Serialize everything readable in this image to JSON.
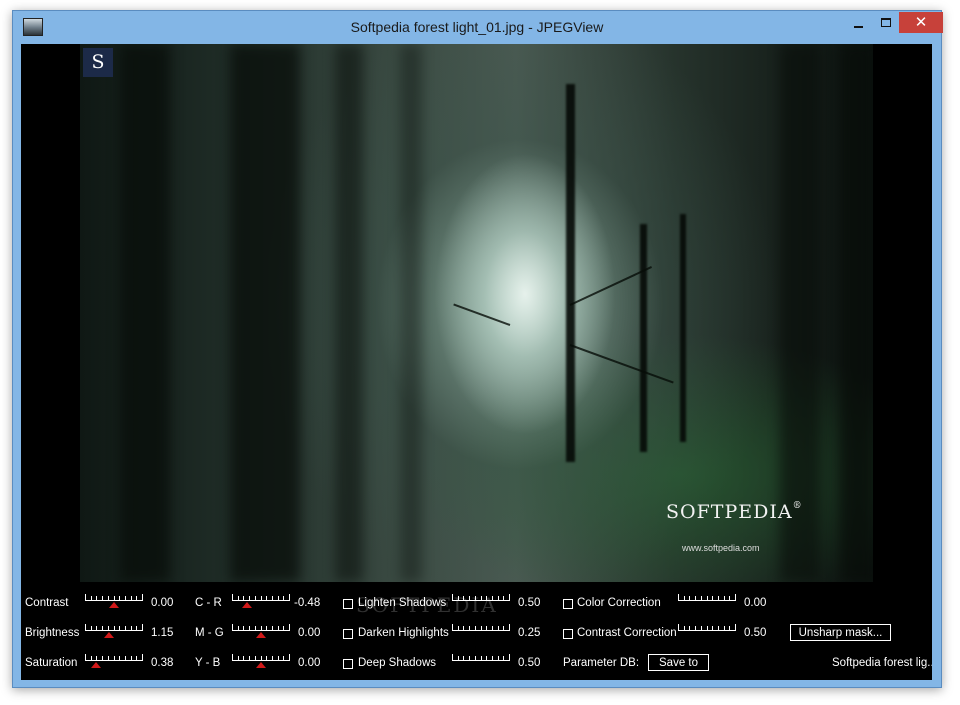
{
  "window": {
    "title": "Softpedia forest light_01.jpg - JPEGView",
    "close_label": "✕"
  },
  "image": {
    "corner_logo": "S",
    "brand": "SOFTPEDIA",
    "brand_mark": "®",
    "brand_url": "www.softpedia.com",
    "watermark": "SOFTPEDIA"
  },
  "controls": {
    "contrast": {
      "label": "Contrast",
      "value": "0.00",
      "thumb": 0.5
    },
    "brightness": {
      "label": "Brightness",
      "value": "1.15",
      "thumb": 0.42
    },
    "saturation": {
      "label": "Saturation",
      "value": "0.38",
      "thumb": 0.19
    },
    "cr": {
      "label": "C - R",
      "value": "-0.48",
      "thumb": 0.26
    },
    "mg": {
      "label": "M - G",
      "value": "0.00",
      "thumb": 0.5
    },
    "yb": {
      "label": "Y - B",
      "value": "0.00",
      "thumb": 0.5
    },
    "lighten_shadows": {
      "label": "Lighten Shadows",
      "value": "0.50",
      "checked": false
    },
    "darken_highlights": {
      "label": "Darken Highlights",
      "value": "0.25",
      "checked": false
    },
    "deep_shadows": {
      "label": "Deep Shadows",
      "value": "0.50",
      "checked": false
    },
    "color_correction": {
      "label": "Color Correction",
      "value": "0.00",
      "checked": false
    },
    "contrast_correction": {
      "label": "Contrast Correction",
      "value": "0.50",
      "checked": false
    },
    "unsharp_label": "Unsharp mask...",
    "param_db_label": "Parameter DB:",
    "save_to_label": "Save to",
    "filename": "Softpedia forest lig..."
  }
}
